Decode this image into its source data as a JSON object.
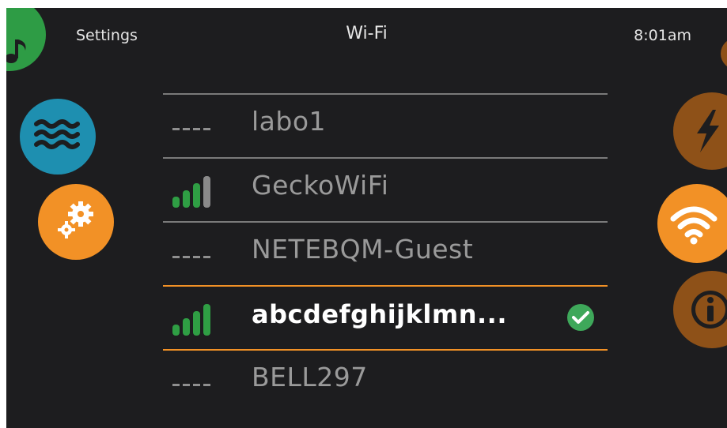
{
  "header": {
    "left_label": "Settings",
    "title": "Wi-Fi",
    "time": "8:01am"
  },
  "side_nav": {
    "left": [
      {
        "icon": "music-note-icon",
        "color": "#2e9c45"
      },
      {
        "icon": "water-waves-icon",
        "color": "#1e8fb0"
      },
      {
        "icon": "gears-icon",
        "color": "#f29126"
      }
    ],
    "right": [
      {
        "icon": "lightning-bolt-icon",
        "color": "#8e5118"
      },
      {
        "icon": "wifi-icon",
        "color": "#f29126"
      },
      {
        "icon": "info-icon",
        "color": "#8e5118"
      }
    ]
  },
  "networks": [
    {
      "name": "labo1",
      "signal": "none"
    },
    {
      "name": "GeckoWiFi",
      "signal": 3
    },
    {
      "name": "NETEBQM-Guest",
      "signal": "none"
    },
    {
      "name": "abcdefghijklmn...",
      "signal": 4,
      "selected": true,
      "connected": true
    },
    {
      "name": "BELL297",
      "signal": "none"
    }
  ],
  "colors": {
    "background": "#1d1d1f",
    "accent_orange": "#f29126",
    "signal_green": "#2f9e44",
    "connected_check": "#3ea85a"
  }
}
